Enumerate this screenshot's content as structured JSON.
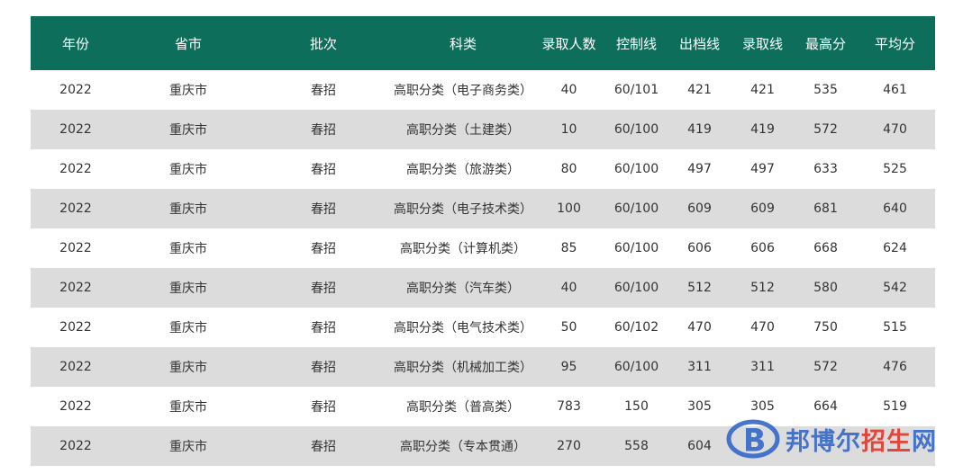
{
  "theme": {
    "header_bg": "#0e6e5c",
    "stripe_bg": "#dcdcdc",
    "watermark_blue": "#3a6bc9",
    "watermark_red": "#e23b2f"
  },
  "table": {
    "headers": [
      "年份",
      "省市",
      "批次",
      "科类",
      "录取人数",
      "控制线",
      "出档线",
      "录取线",
      "最高分",
      "平均分"
    ],
    "rows": [
      [
        "2022",
        "重庆市",
        "春招",
        "高职分类（电子商务类）",
        "40",
        "60/101",
        "421",
        "421",
        "535",
        "461"
      ],
      [
        "2022",
        "重庆市",
        "春招",
        "高职分类（土建类）",
        "10",
        "60/100",
        "419",
        "419",
        "572",
        "470"
      ],
      [
        "2022",
        "重庆市",
        "春招",
        "高职分类（旅游类）",
        "80",
        "60/100",
        "497",
        "497",
        "633",
        "525"
      ],
      [
        "2022",
        "重庆市",
        "春招",
        "高职分类（电子技术类）",
        "100",
        "60/100",
        "609",
        "609",
        "681",
        "640"
      ],
      [
        "2022",
        "重庆市",
        "春招",
        "高职分类（计算机类）",
        "85",
        "60/100",
        "606",
        "606",
        "668",
        "624"
      ],
      [
        "2022",
        "重庆市",
        "春招",
        "高职分类（汽车类）",
        "40",
        "60/100",
        "512",
        "512",
        "580",
        "542"
      ],
      [
        "2022",
        "重庆市",
        "春招",
        "高职分类（电气技术类）",
        "50",
        "60/102",
        "470",
        "470",
        "750",
        "515"
      ],
      [
        "2022",
        "重庆市",
        "春招",
        "高职分类（机械加工类）",
        "95",
        "60/100",
        "311",
        "311",
        "572",
        "476"
      ],
      [
        "2022",
        "重庆市",
        "春招",
        "高职分类（普高类）",
        "783",
        "150",
        "305",
        "305",
        "664",
        "519"
      ],
      [
        "2022",
        "重庆市",
        "春招",
        "高职分类（专本贯通）",
        "270",
        "558",
        "604",
        "",
        "",
        ""
      ]
    ]
  },
  "watermark": {
    "icon": "b-logo-icon",
    "text_blue": "邦博尔",
    "text_red": "招生",
    "text_blue_2": "网"
  }
}
